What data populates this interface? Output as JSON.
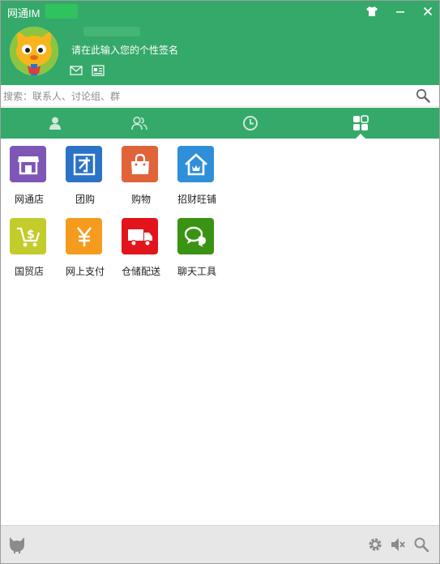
{
  "window": {
    "title": "网通IM"
  },
  "profile": {
    "signature": "请在此输入您的个性签名"
  },
  "search": {
    "placeholder": "搜索：联系人、讨论组、群"
  },
  "tabs": [
    {
      "name": "contacts",
      "icon": "person-icon"
    },
    {
      "name": "groups",
      "icon": "group-icon"
    },
    {
      "name": "recent",
      "icon": "clock-icon"
    },
    {
      "name": "apps",
      "icon": "grid-icon",
      "active": true
    }
  ],
  "apps": [
    {
      "label": "网通店",
      "icon": "store-icon",
      "color": "#7d56b6"
    },
    {
      "label": "团购",
      "icon": "tuan-icon",
      "color": "#2a73c6"
    },
    {
      "label": "购物",
      "icon": "shopping-bag-icon",
      "color": "#e0633a"
    },
    {
      "label": "招财旺铺",
      "icon": "shop-house-icon",
      "color": "#2f8fd8"
    },
    {
      "label": "国贸店",
      "icon": "dollar-cart-icon",
      "color": "#c2cc2a"
    },
    {
      "label": "网上支付",
      "icon": "yuan-icon",
      "color": "#f59b1d"
    },
    {
      "label": "仓储配送",
      "icon": "truck-icon",
      "color": "#e2151c"
    },
    {
      "label": "聊天工具",
      "icon": "chat-bubbles-icon",
      "color": "#3a9312"
    }
  ],
  "colors": {
    "header": "#35a96a",
    "footer": "#e7e7e7"
  }
}
